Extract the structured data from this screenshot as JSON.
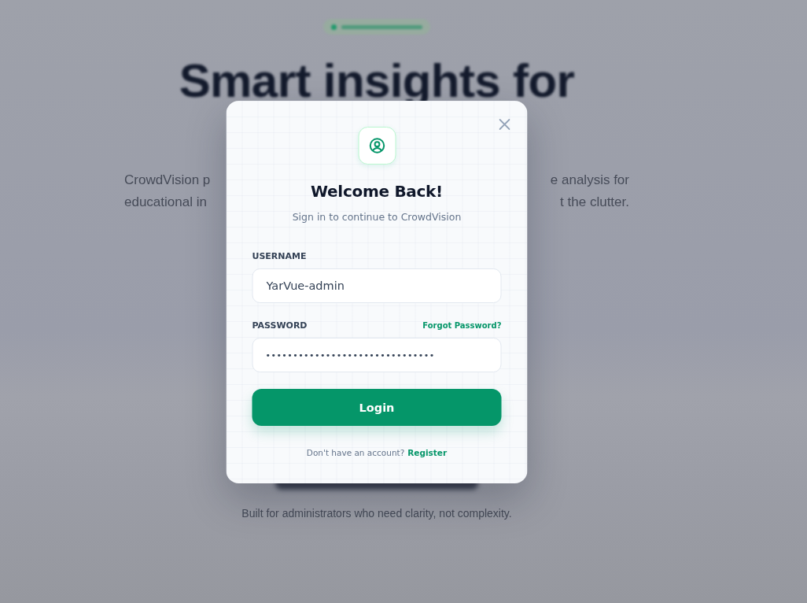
{
  "background_page": {
    "headline": "Smart insights for",
    "intro_lines": [
      {
        "left": "CrowdVision p",
        "right": "e analysis for"
      },
      {
        "left": "educational in",
        "right": "t the clutter."
      }
    ],
    "section": {
      "subtitle": "Built for administrators who need clarity, not complexity."
    }
  },
  "dialog": {
    "title": "Welcome Back!",
    "subtitle": "Sign in to continue to CrowdVision",
    "fields": [
      {
        "kind": "text",
        "label": "USERNAME",
        "value": "YarVue-admin"
      },
      {
        "kind": "password",
        "label": "PASSWORD",
        "link": "Forgot Password?",
        "value": "•••••••••••••••••••••••••••••••"
      }
    ],
    "submit": "Login",
    "footer": {
      "text": "Don't have an account?",
      "link": "Register"
    }
  }
}
